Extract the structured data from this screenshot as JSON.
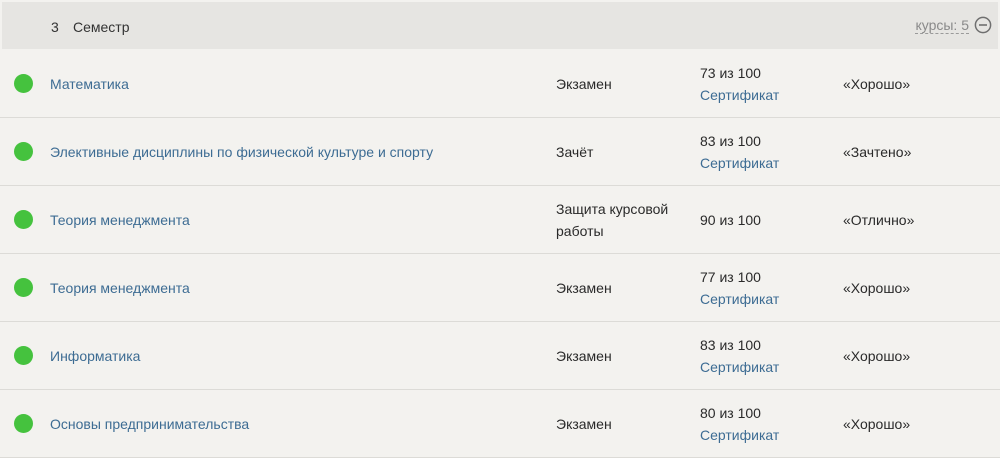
{
  "colors": {
    "status_green": "#45c23e",
    "link": "#3d6c93"
  },
  "semester": {
    "number": "3",
    "label": "Семестр",
    "courses_count": "курсы: 5",
    "toggle_icon": "collapse-minus-icon"
  },
  "courses": [
    {
      "name": "Математика",
      "type": "Экзамен",
      "score": "73 из 100",
      "certificate": "Сертификат",
      "grade": "«Хорошо»"
    },
    {
      "name": "Элективные дисциплины по физической культуре и спорту",
      "type": "Зачёт",
      "score": "83 из 100",
      "certificate": "Сертификат",
      "grade": "«Зачтено»"
    },
    {
      "name": "Теория менеджмента",
      "type": "Защита курсовой работы",
      "score": "90 из 100",
      "certificate": "",
      "grade": "«Отлично»"
    },
    {
      "name": "Теория менеджмента",
      "type": "Экзамен",
      "score": "77 из 100",
      "certificate": "Сертификат",
      "grade": "«Хорошо»"
    },
    {
      "name": "Информатика",
      "type": "Экзамен",
      "score": "83 из 100",
      "certificate": "Сертификат",
      "grade": "«Хорошо»"
    },
    {
      "name": "Основы предпринимательства",
      "type": "Экзамен",
      "score": "80 из 100",
      "certificate": "Сертификат",
      "grade": "«Хорошо»"
    }
  ]
}
